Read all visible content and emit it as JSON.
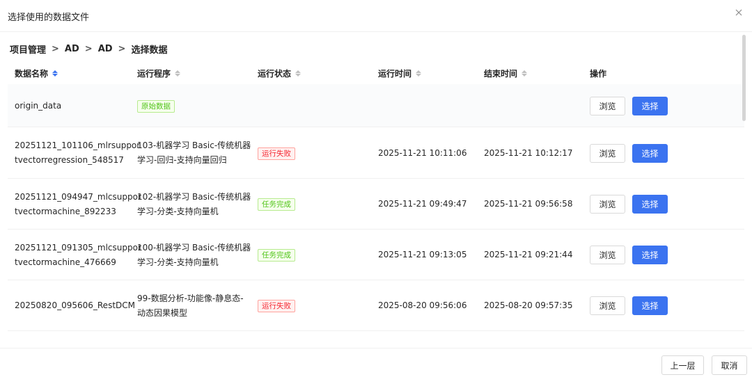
{
  "dialog": {
    "title": "选择使用的数据文件",
    "close_icon": "close-icon"
  },
  "breadcrumb": [
    "项目管理",
    "AD",
    "AD",
    "选择数据"
  ],
  "table": {
    "columns": [
      {
        "label": "数据名称",
        "sorted": true
      },
      {
        "label": "运行程序",
        "sorted": false
      },
      {
        "label": "运行状态",
        "sorted": false
      },
      {
        "label": "运行时间",
        "sorted": false
      },
      {
        "label": "结束时间",
        "sorted": false
      },
      {
        "label": "操作",
        "sorted": false
      }
    ],
    "rows": [
      {
        "name": [
          "origin_data"
        ],
        "program": [],
        "status": "原始数据",
        "status_type": "ok",
        "start": "",
        "end": "",
        "browse": "浏览",
        "select": "选择"
      },
      {
        "name": [
          "20251121_101106_mlrsuppor",
          "tvectorregression_548517"
        ],
        "program": [
          "103-机器学习 Basic-传统机器",
          "学习-回归-支持向量回归"
        ],
        "status": "运行失败",
        "status_type": "fail",
        "start": "2025-11-21 10:11:06",
        "end": "2025-11-21 10:12:17",
        "browse": "浏览",
        "select": "选择"
      },
      {
        "name": [
          "20251121_094947_mlcsuppor",
          "tvectormachine_892233"
        ],
        "program": [
          "102-机器学习 Basic-传统机器",
          "学习-分类-支持向量机"
        ],
        "status": "任务完成",
        "status_type": "ok",
        "start": "2025-11-21 09:49:47",
        "end": "2025-11-21 09:56:58",
        "browse": "浏览",
        "select": "选择"
      },
      {
        "name": [
          "20251121_091305_mlcsuppor",
          "tvectormachine_476669"
        ],
        "program": [
          "100-机器学习 Basic-传统机器",
          "学习-分类-支持向量机"
        ],
        "status": "任务完成",
        "status_type": "ok",
        "start": "2025-11-21 09:13:05",
        "end": "2025-11-21 09:21:44",
        "browse": "浏览",
        "select": "选择"
      },
      {
        "name": [
          "20250820_095606_RestDCM"
        ],
        "program": [
          "99-数据分析-功能像-静息态-",
          "动态因果模型"
        ],
        "status": "运行失败",
        "status_type": "fail",
        "start": "2025-08-20 09:56:06",
        "end": "2025-08-20 09:57:35",
        "browse": "浏览",
        "select": "选择"
      }
    ]
  },
  "footer": {
    "prev_label": "上一层",
    "cancel_label": "取消"
  },
  "colors": {
    "primary": "#3b73f0",
    "success": "#52c41a",
    "error": "#f5222d"
  }
}
